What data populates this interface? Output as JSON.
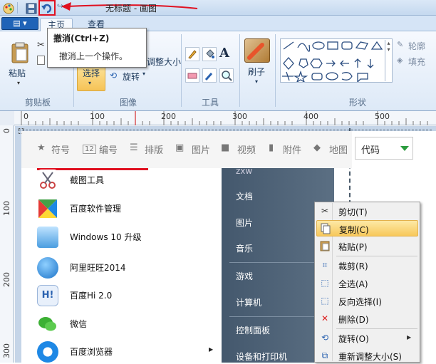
{
  "titlebar": {
    "title": "无标题 - 画图"
  },
  "tabs": {
    "file": "▤ ▾",
    "home": "主页",
    "view": "查看"
  },
  "tooltip": {
    "title": "撤消(Ctrl+Z)",
    "desc": "撤消上一个操作。"
  },
  "ribbon": {
    "paste": "粘贴",
    "clipboard": "剪贴板",
    "select": "选择",
    "resize": "调整大小",
    "rotate": "旋转",
    "image": "图像",
    "tools": "工具",
    "brush": "刷子",
    "shapes": "形状",
    "outline": "轮廓",
    "fill": "填充",
    "text_tool": "A"
  },
  "ruler": {
    "h": [
      "0",
      "100",
      "200",
      "300",
      "400",
      "500"
    ],
    "v": [
      "0",
      "100",
      "200",
      "300"
    ]
  },
  "inner_toolbar": {
    "items": [
      "符号",
      "编号",
      "排版",
      "图片",
      "视频",
      "附件",
      "地图"
    ],
    "select_value": "代码"
  },
  "start_menu": {
    "apps": [
      "截图工具",
      "百度软件管理",
      "Windows 10 升级",
      "阿里旺旺2014",
      "百度Hi 2.0",
      "微信",
      "百度浏览器"
    ],
    "right": [
      "zxw",
      "文档",
      "图片",
      "音乐",
      "游戏",
      "计算机",
      "控制面板",
      "设备和打印机"
    ]
  },
  "context_menu": {
    "items": [
      "剪切(T)",
      "复制(C)",
      "粘贴(P)",
      "裁剪(R)",
      "全选(A)",
      "反向选择(I)",
      "删除(D)",
      "旋转(O)",
      "重新调整大小(S)"
    ],
    "highlighted": "复制(C)"
  },
  "colors": {
    "accent": "#1f63b7",
    "annotation": "#e01020",
    "highlight": "#f7c85b"
  }
}
